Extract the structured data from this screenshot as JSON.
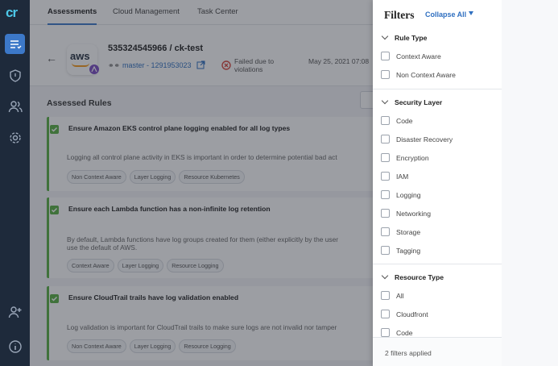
{
  "rail": {
    "logo": "cr",
    "icons": [
      "assessments-icon",
      "shield-icon",
      "users-icon",
      "settings-icon",
      "add-user-icon",
      "info-icon"
    ]
  },
  "tabs": [
    "Assessments",
    "Cloud Management",
    "Task Center"
  ],
  "header": {
    "account": "535324545966 / ck-test",
    "branch": "master - 1291953023",
    "status": "Failed due to violations",
    "date": "May 25, 2021 07:08",
    "logo_text": "aws"
  },
  "section_title": "Assessed Rules",
  "rules": [
    {
      "title": "Ensure Amazon EKS control plane logging enabled for all log types",
      "desc": [
        "Logging all control plane activity in EKS is important in order to determine potential bad act"
      ],
      "tags": [
        "Non Context Aware",
        "Layer Logging",
        "Resource Kubernetes"
      ]
    },
    {
      "title": "Ensure each Lambda function has a non-infinite log retention",
      "desc": [
        "By default, Lambda functions have log groups created for them (either explicitly by the user",
        "use the default of AWS."
      ],
      "tags": [
        "Context Aware",
        "Layer Logging",
        "Resource Logging"
      ]
    },
    {
      "title": "Ensure CloudTrail trails have log validation enabled",
      "desc": [
        "Log validation is important for CloudTrail trails to make sure logs are not invalid nor tamper"
      ],
      "tags": [
        "Non Context Aware",
        "Layer Logging",
        "Resource Logging"
      ]
    }
  ],
  "filters": {
    "title": "Filters",
    "collapse_label": "Collapse All",
    "sections": [
      {
        "name": "Rule Type",
        "options": [
          "Context Aware",
          "Non Context Aware"
        ]
      },
      {
        "name": "Security Layer",
        "options": [
          "Code",
          "Disaster Recovery",
          "Encryption",
          "IAM",
          "Logging",
          "Networking",
          "Storage",
          "Tagging"
        ]
      },
      {
        "name": "Resource Type",
        "options": [
          "All",
          "Cloudfront",
          "Code"
        ]
      }
    ],
    "footer": "2 filters applied"
  },
  "colors": {
    "accent": "#2f6fc0",
    "pass": "#58b043",
    "rail": "#1e2a3b",
    "fail": "#d9453c"
  }
}
